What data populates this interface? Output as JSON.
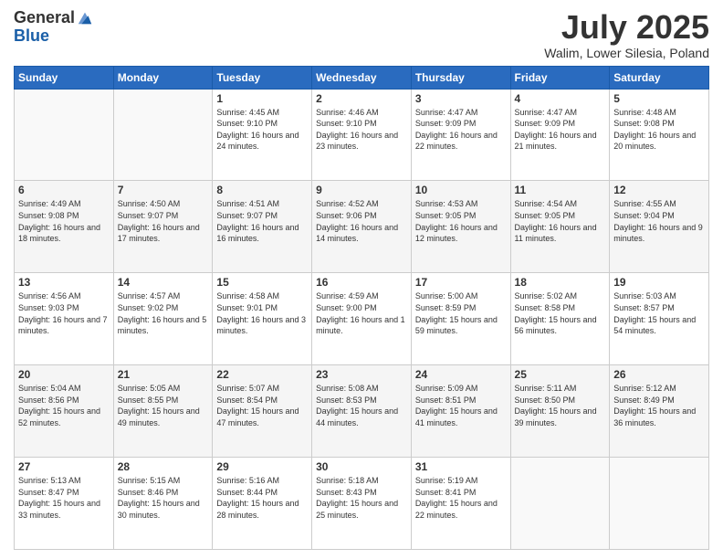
{
  "logo": {
    "general": "General",
    "blue": "Blue"
  },
  "title": "July 2025",
  "location": "Walim, Lower Silesia, Poland",
  "weekdays": [
    "Sunday",
    "Monday",
    "Tuesday",
    "Wednesday",
    "Thursday",
    "Friday",
    "Saturday"
  ],
  "weeks": [
    [
      {
        "day": "",
        "info": ""
      },
      {
        "day": "",
        "info": ""
      },
      {
        "day": "1",
        "info": "Sunrise: 4:45 AM\nSunset: 9:10 PM\nDaylight: 16 hours and 24 minutes."
      },
      {
        "day": "2",
        "info": "Sunrise: 4:46 AM\nSunset: 9:10 PM\nDaylight: 16 hours and 23 minutes."
      },
      {
        "day": "3",
        "info": "Sunrise: 4:47 AM\nSunset: 9:09 PM\nDaylight: 16 hours and 22 minutes."
      },
      {
        "day": "4",
        "info": "Sunrise: 4:47 AM\nSunset: 9:09 PM\nDaylight: 16 hours and 21 minutes."
      },
      {
        "day": "5",
        "info": "Sunrise: 4:48 AM\nSunset: 9:08 PM\nDaylight: 16 hours and 20 minutes."
      }
    ],
    [
      {
        "day": "6",
        "info": "Sunrise: 4:49 AM\nSunset: 9:08 PM\nDaylight: 16 hours and 18 minutes."
      },
      {
        "day": "7",
        "info": "Sunrise: 4:50 AM\nSunset: 9:07 PM\nDaylight: 16 hours and 17 minutes."
      },
      {
        "day": "8",
        "info": "Sunrise: 4:51 AM\nSunset: 9:07 PM\nDaylight: 16 hours and 16 minutes."
      },
      {
        "day": "9",
        "info": "Sunrise: 4:52 AM\nSunset: 9:06 PM\nDaylight: 16 hours and 14 minutes."
      },
      {
        "day": "10",
        "info": "Sunrise: 4:53 AM\nSunset: 9:05 PM\nDaylight: 16 hours and 12 minutes."
      },
      {
        "day": "11",
        "info": "Sunrise: 4:54 AM\nSunset: 9:05 PM\nDaylight: 16 hours and 11 minutes."
      },
      {
        "day": "12",
        "info": "Sunrise: 4:55 AM\nSunset: 9:04 PM\nDaylight: 16 hours and 9 minutes."
      }
    ],
    [
      {
        "day": "13",
        "info": "Sunrise: 4:56 AM\nSunset: 9:03 PM\nDaylight: 16 hours and 7 minutes."
      },
      {
        "day": "14",
        "info": "Sunrise: 4:57 AM\nSunset: 9:02 PM\nDaylight: 16 hours and 5 minutes."
      },
      {
        "day": "15",
        "info": "Sunrise: 4:58 AM\nSunset: 9:01 PM\nDaylight: 16 hours and 3 minutes."
      },
      {
        "day": "16",
        "info": "Sunrise: 4:59 AM\nSunset: 9:00 PM\nDaylight: 16 hours and 1 minute."
      },
      {
        "day": "17",
        "info": "Sunrise: 5:00 AM\nSunset: 8:59 PM\nDaylight: 15 hours and 59 minutes."
      },
      {
        "day": "18",
        "info": "Sunrise: 5:02 AM\nSunset: 8:58 PM\nDaylight: 15 hours and 56 minutes."
      },
      {
        "day": "19",
        "info": "Sunrise: 5:03 AM\nSunset: 8:57 PM\nDaylight: 15 hours and 54 minutes."
      }
    ],
    [
      {
        "day": "20",
        "info": "Sunrise: 5:04 AM\nSunset: 8:56 PM\nDaylight: 15 hours and 52 minutes."
      },
      {
        "day": "21",
        "info": "Sunrise: 5:05 AM\nSunset: 8:55 PM\nDaylight: 15 hours and 49 minutes."
      },
      {
        "day": "22",
        "info": "Sunrise: 5:07 AM\nSunset: 8:54 PM\nDaylight: 15 hours and 47 minutes."
      },
      {
        "day": "23",
        "info": "Sunrise: 5:08 AM\nSunset: 8:53 PM\nDaylight: 15 hours and 44 minutes."
      },
      {
        "day": "24",
        "info": "Sunrise: 5:09 AM\nSunset: 8:51 PM\nDaylight: 15 hours and 41 minutes."
      },
      {
        "day": "25",
        "info": "Sunrise: 5:11 AM\nSunset: 8:50 PM\nDaylight: 15 hours and 39 minutes."
      },
      {
        "day": "26",
        "info": "Sunrise: 5:12 AM\nSunset: 8:49 PM\nDaylight: 15 hours and 36 minutes."
      }
    ],
    [
      {
        "day": "27",
        "info": "Sunrise: 5:13 AM\nSunset: 8:47 PM\nDaylight: 15 hours and 33 minutes."
      },
      {
        "day": "28",
        "info": "Sunrise: 5:15 AM\nSunset: 8:46 PM\nDaylight: 15 hours and 30 minutes."
      },
      {
        "day": "29",
        "info": "Sunrise: 5:16 AM\nSunset: 8:44 PM\nDaylight: 15 hours and 28 minutes."
      },
      {
        "day": "30",
        "info": "Sunrise: 5:18 AM\nSunset: 8:43 PM\nDaylight: 15 hours and 25 minutes."
      },
      {
        "day": "31",
        "info": "Sunrise: 5:19 AM\nSunset: 8:41 PM\nDaylight: 15 hours and 22 minutes."
      },
      {
        "day": "",
        "info": ""
      },
      {
        "day": "",
        "info": ""
      }
    ]
  ]
}
